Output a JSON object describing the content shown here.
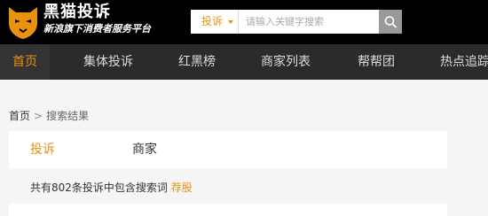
{
  "header": {
    "logo_title": "黑猫投诉",
    "logo_subtitle": "新浪旗下消费者服务平台",
    "logo_icon": "cat-logo-icon"
  },
  "search": {
    "type_label": "投诉",
    "placeholder": "请输入关键字搜索",
    "value": "",
    "button_icon": "search-icon"
  },
  "nav": {
    "items": [
      {
        "label": "首页",
        "active": true
      },
      {
        "label": "集体投诉"
      },
      {
        "label": "红黑榜"
      },
      {
        "label": "商家列表"
      },
      {
        "label": "帮帮团"
      },
      {
        "label": "热点追踪"
      }
    ]
  },
  "breadcrumb": {
    "home": "首页",
    "separator": ">",
    "current": "搜索结果"
  },
  "tabs": {
    "items": [
      {
        "label": "投诉",
        "active": true
      },
      {
        "label": "商家"
      }
    ]
  },
  "result": {
    "text": "共有802条投诉中包含搜索词",
    "keyword": "荐股"
  },
  "colors": {
    "accent": "#e8920f",
    "topbar": "#000000",
    "nav": "#2b2b2b",
    "page_bg": "#f5f5f5"
  }
}
